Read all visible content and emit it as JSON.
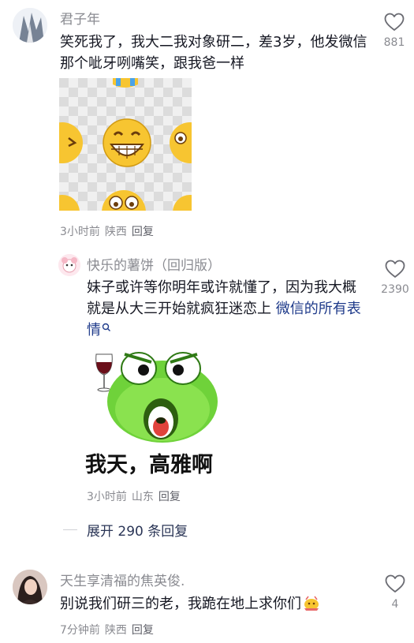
{
  "comments": [
    {
      "username": "君子年",
      "text": "笑死我了，我大二我对象研二，差3岁，他发微信那个呲牙咧嘴笑，跟我爸一样",
      "time": "3小时前",
      "location": "陕西",
      "reply_label": "回复",
      "likes": "881",
      "sticker": "grinning-emoji-grid"
    },
    {
      "username": "天生享清福的焦英俊.",
      "text": "别说我们研三的老，我跪在地上求你们",
      "time": "7分钟前",
      "location": "陕西",
      "reply_label": "回复",
      "likes": "4"
    }
  ],
  "reply": {
    "username": "快乐的薯饼（回归版）",
    "text": "妹子或许等你明年或许就懂了，因为我大概就是从大三开始就疯狂迷恋上 ",
    "link_text": "微信的所有表情",
    "sticker_caption": "我天，高雅啊",
    "time": "3小时前",
    "location": "山东",
    "reply_label": "回复",
    "likes": "2390"
  },
  "expand_replies": "展开 290 条回复",
  "icons": [
    "heart-icon",
    "search-icon",
    "wine-glass-icon",
    "avatar"
  ],
  "colors": {
    "text": "#161823",
    "secondary": "#8a8b91",
    "link": "#1e3a8a",
    "emoji_yellow": "#f7c531",
    "frog_green": "#6fd23a"
  }
}
